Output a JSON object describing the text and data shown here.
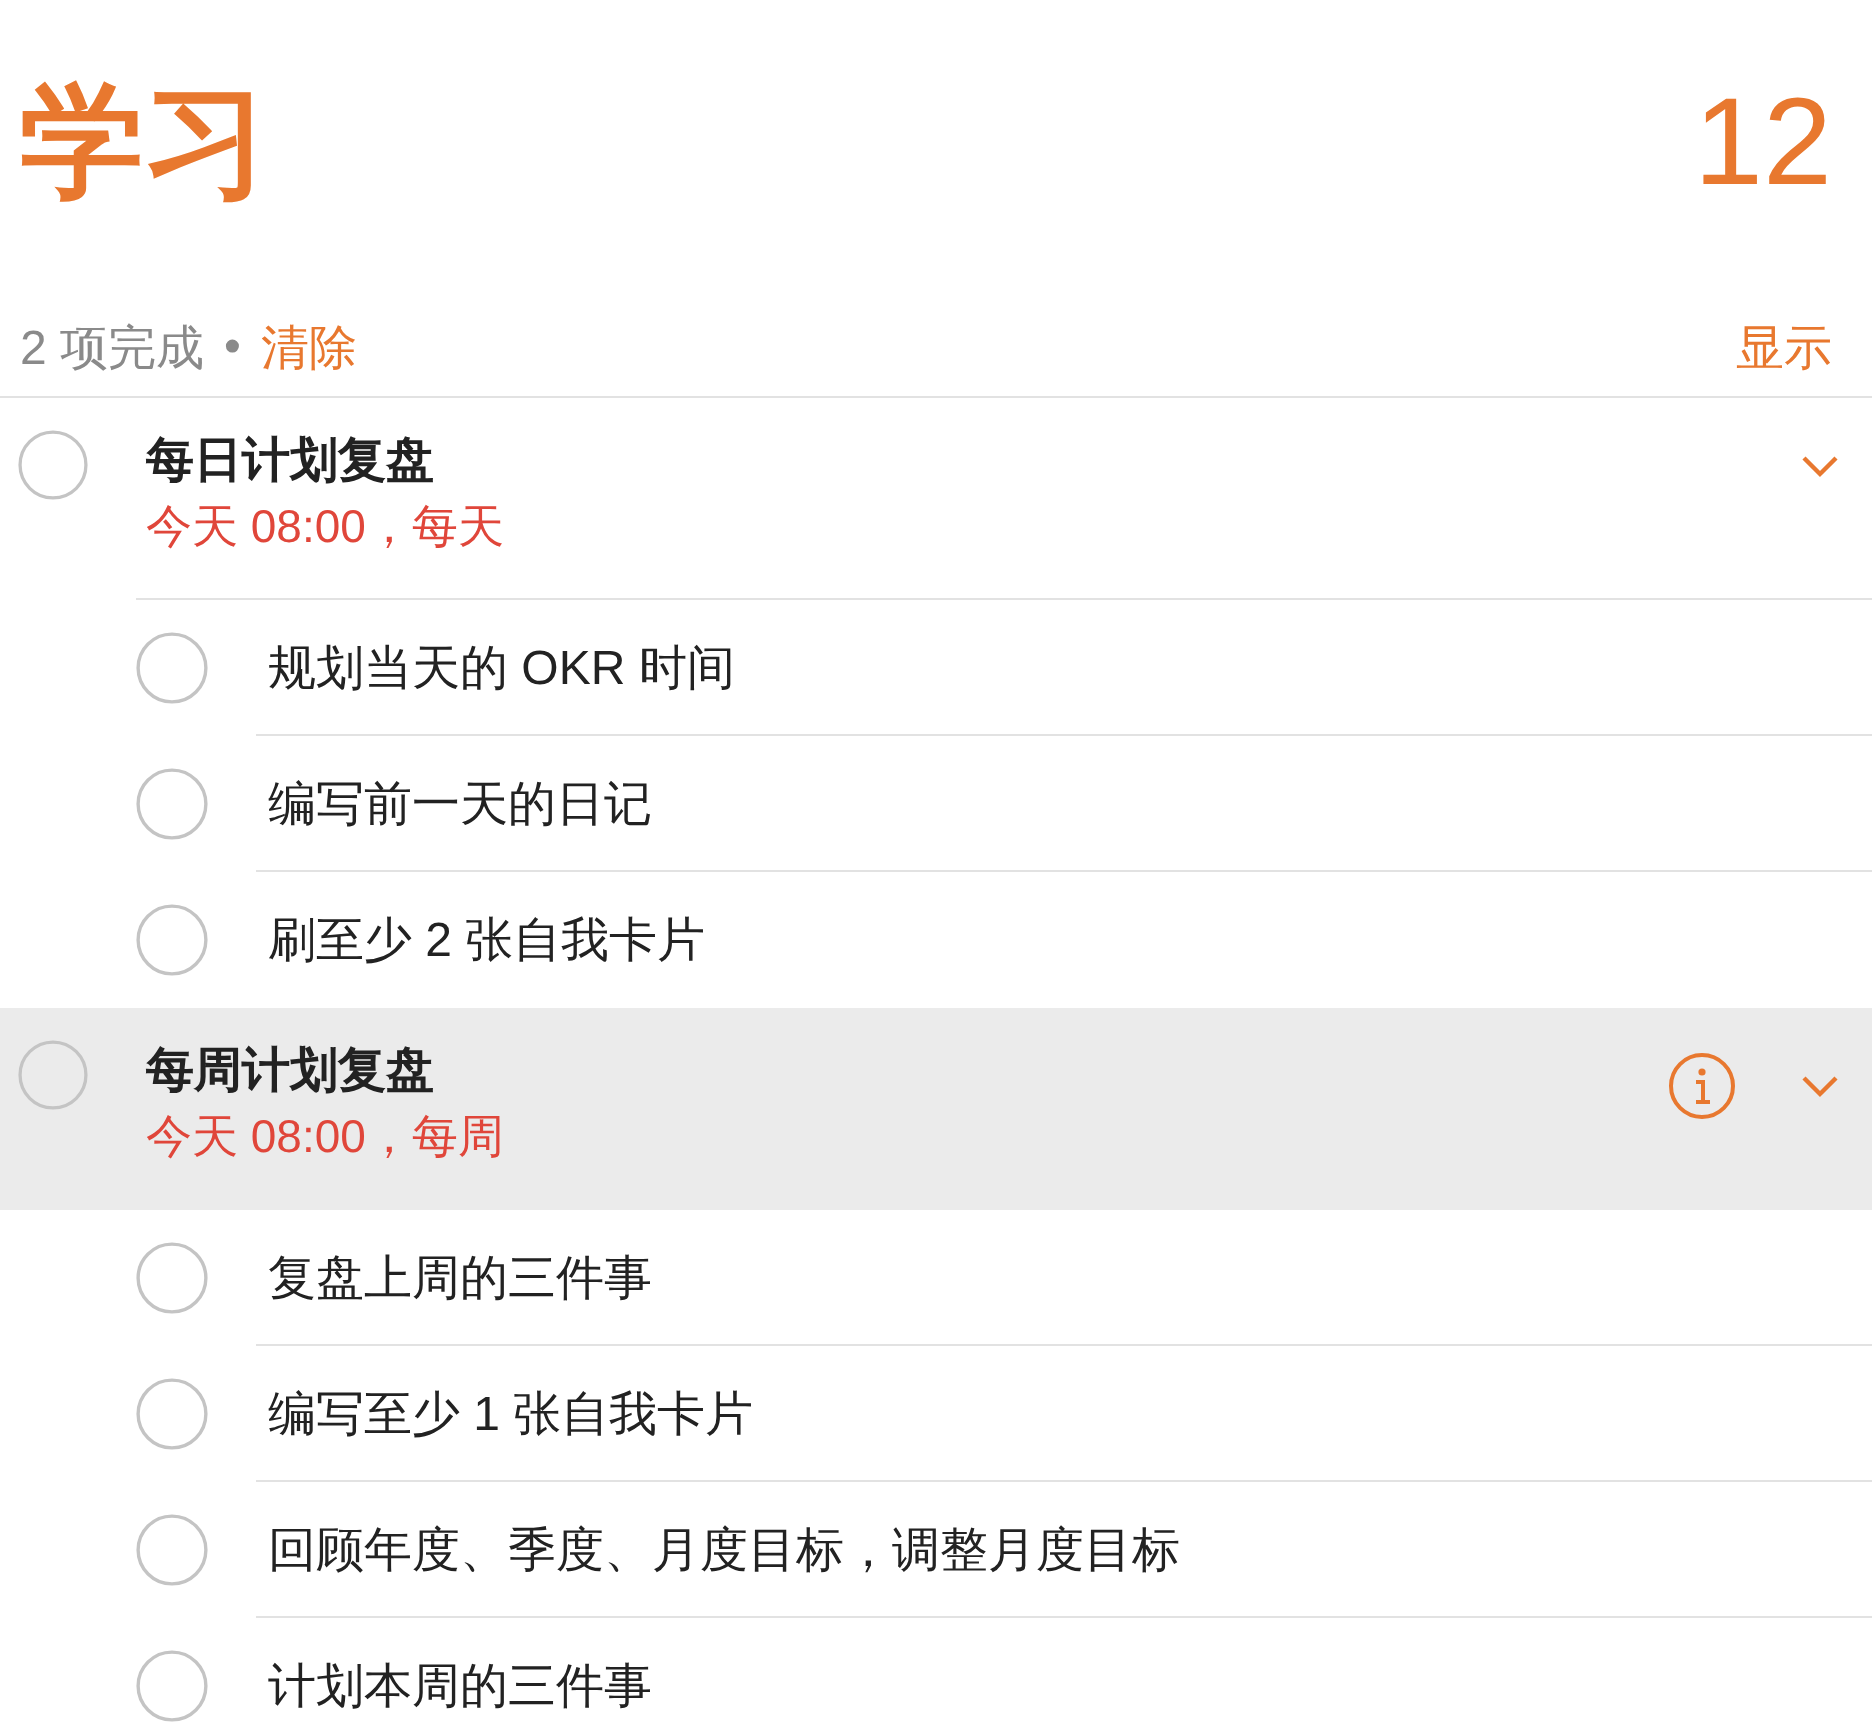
{
  "list": {
    "title": "学习",
    "count": "12"
  },
  "summary": {
    "completed": "2 项完成",
    "separator": "•",
    "clear": "清除",
    "show": "显示"
  },
  "tasks": [
    {
      "title": "每日计划复盘",
      "due": "今天 08:00，每天",
      "done": false,
      "selected": false,
      "expanded": true,
      "subtasks": [
        {
          "title": "规划当天的 OKR 时间",
          "done": false
        },
        {
          "title": "编写前一天的日记",
          "done": false
        },
        {
          "title": "刷至少 2 张自我卡片",
          "done": false
        }
      ]
    },
    {
      "title": "每周计划复盘",
      "due": "今天 08:00，每周",
      "done": false,
      "selected": true,
      "expanded": true,
      "subtasks": [
        {
          "title": "复盘上周的三件事",
          "done": false
        },
        {
          "title": "编写至少 1 张自我卡片",
          "done": false
        },
        {
          "title": "回顾年度、季度、月度目标，调整月度目标",
          "done": false
        },
        {
          "title": "计划本周的三件事",
          "done": false
        }
      ]
    }
  ]
}
